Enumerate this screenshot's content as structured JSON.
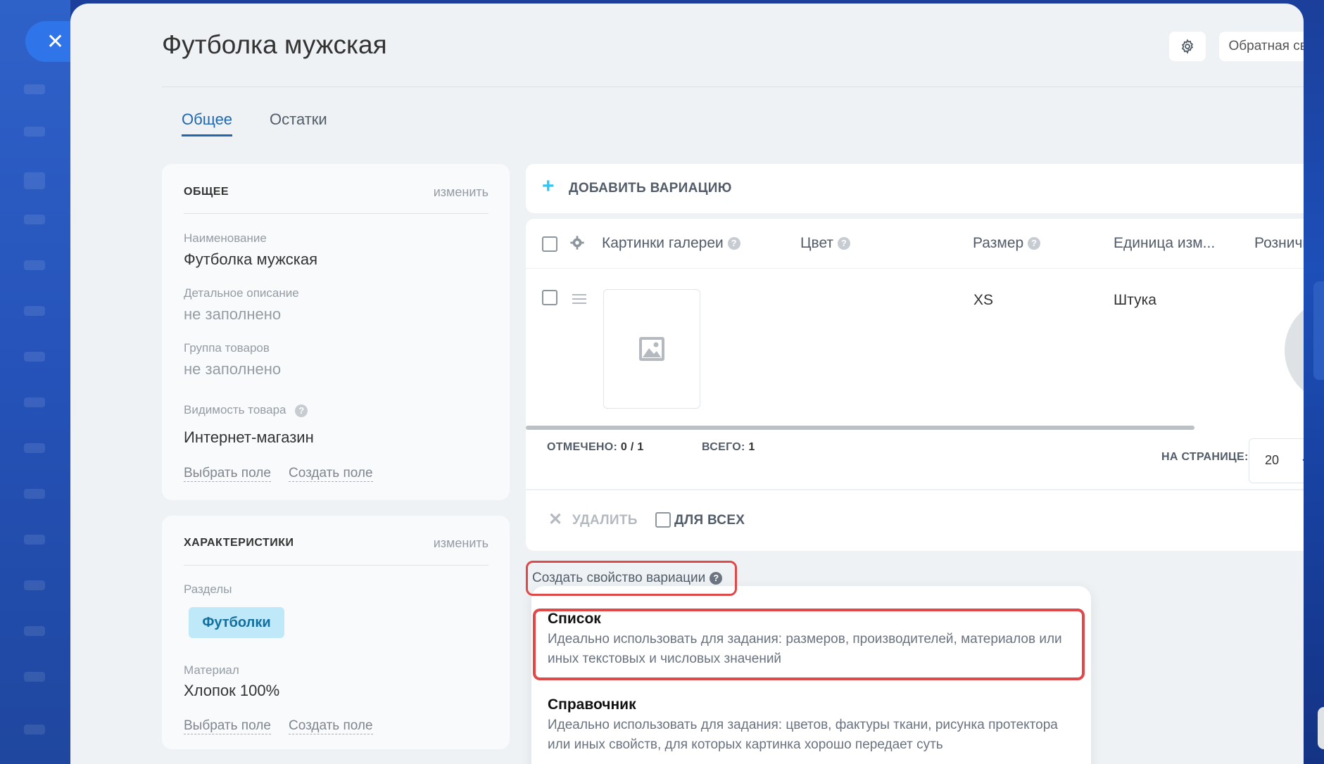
{
  "window": {
    "close_glyph": "✕"
  },
  "header": {
    "title": "Футболка мужская",
    "settings_icon": "gear-icon",
    "feedback_label": "Обратная связь"
  },
  "tabs": [
    {
      "label": "Общее",
      "active": true
    },
    {
      "label": "Остатки",
      "active": false
    }
  ],
  "general_card": {
    "title": "ОБЩЕЕ",
    "edit_label": "изменить",
    "fields": [
      {
        "label": "Наименование",
        "value": "Футболка мужская"
      },
      {
        "label": "Детальное описание",
        "value": "не заполнено"
      },
      {
        "label": "Группа товаров",
        "value": "не заполнено"
      },
      {
        "label": "Видимость товара",
        "value": "Интернет-магазин"
      }
    ],
    "select_field": "Выбрать поле",
    "create_field": "Создать поле"
  },
  "chars_card": {
    "title": "ХАРАКТЕРИСТИКИ",
    "edit_label": "изменить",
    "sections_label": "Разделы",
    "section_tag": "Футболки",
    "material_label": "Материал",
    "material_value": "Хлопок 100%",
    "select_field": "Выбрать поле",
    "create_field": "Создать поле"
  },
  "variations": {
    "add_label": "ДОБАВИТЬ ВАРИАЦИЮ",
    "columns": [
      "Картинки галереи",
      "Цвет",
      "Размер",
      "Единица изм...",
      "Розничная ц"
    ],
    "rows": [
      {
        "size": "XS",
        "unit": "Штука"
      }
    ],
    "marked_label": "ОТМЕЧЕНО:",
    "marked_value": "0 / 1",
    "total_label": "ВСЕГО:",
    "total_value": "1",
    "per_page_label": "НА СТРАНИЦЕ:",
    "per_page_value": "20",
    "delete_label": "УДАЛИТЬ",
    "for_all_label": "ДЛЯ ВСЕХ"
  },
  "create_property": {
    "label": "Создать свойство вариации",
    "options": [
      {
        "title": "Список",
        "description": "Идеально использовать для задания: размеров, производителей, материалов или иных текстовых и числовых значений"
      },
      {
        "title": "Справочник",
        "description": "Идеально использовать для задания: цветов, фактуры ткани, рисунка протектора или иных свойств, для которых картинка хорошо передает суть"
      }
    ]
  },
  "colors": {
    "accent": "#2067b0",
    "highlight": "#e04949",
    "tag_bg": "#bfe8f8"
  }
}
